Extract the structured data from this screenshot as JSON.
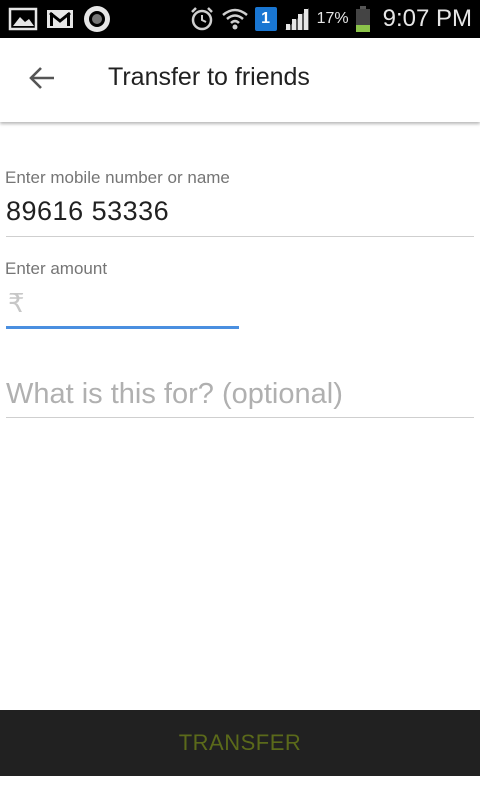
{
  "status_bar": {
    "left_icons": [
      "gallery-icon",
      "gmail-icon",
      "circle-app-icon"
    ],
    "sim_slot": "1",
    "battery_percent": "17%",
    "time": "9:07 PM",
    "colors": {
      "background": "#000000",
      "battery_fill": "#8bc34a",
      "sim_badge": "#1976d2"
    }
  },
  "toolbar": {
    "back_icon": "arrow-back-icon",
    "title": "Transfer to friends"
  },
  "form": {
    "recipient": {
      "label": "Enter mobile number or name",
      "value": "89616 53336"
    },
    "amount": {
      "label": "Enter amount",
      "currency_symbol": "₹",
      "value": ""
    },
    "note": {
      "placeholder": "What is this for? (optional)",
      "value": ""
    }
  },
  "actions": {
    "transfer_label": "TRANSFER",
    "colors": {
      "button_bg": "#212121",
      "label": "#5b6a1a",
      "focus_underline": "#4a8fe0"
    }
  }
}
